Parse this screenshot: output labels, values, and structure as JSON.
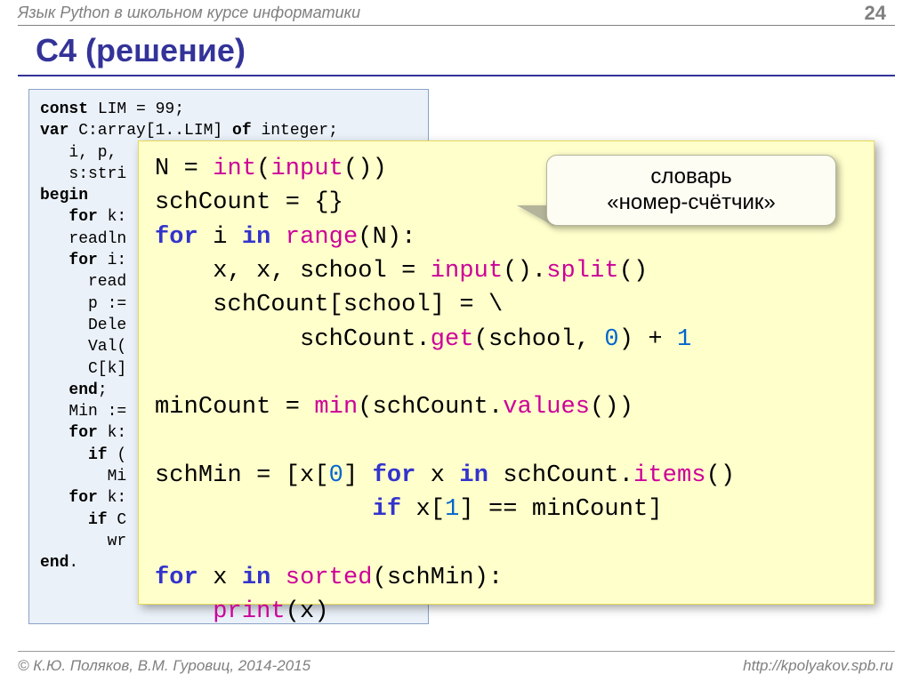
{
  "header": {
    "course": "Язык Python в школьном курсе информатики",
    "page": "24"
  },
  "title": "C4 (решение)",
  "pascal": {
    "l1a": "const",
    "l1b": " LIM = 99;",
    "l2a": "var",
    "l2b": " C:array[1..LIM] ",
    "l2c": "of",
    "l2d": " integer;",
    "l3": "   i, p, ",
    "l4": "   s:stri",
    "l5a": "begin",
    "l6a": "   for",
    "l6b": " k:",
    "l7": "   readln",
    "l8a": "   for",
    "l8b": " i:",
    "l9": "     read",
    "l10": "     p :=",
    "l11": "     Dele",
    "l12": "     Val(",
    "l13": "     C[k]",
    "l14a": "   end",
    "l14b": ";",
    "l15": "   Min :=",
    "l16a": "   for",
    "l16b": " k:",
    "l17a": "     if",
    "l17b": " (",
    "l18": "       Mi",
    "l19a": "   for",
    "l19b": " k:",
    "l20a": "     if",
    "l20b": " C",
    "l21": "       wr",
    "l22a": "end",
    "l22b": "."
  },
  "python": {
    "l1a": "N = ",
    "l1b": "int",
    "l1c": "(",
    "l1d": "input",
    "l1e": "())",
    "l2": "schCount = {}",
    "l3a": "for",
    "l3b": " i ",
    "l3c": "in",
    "l3d": " ",
    "l3e": "range",
    "l3f": "(N):",
    "l4a": "    x, x, school = ",
    "l4b": "input",
    "l4c": "().",
    "l4d": "split",
    "l4e": "()",
    "l5": "    schCount[school] = \\",
    "l6a": "          schCount.",
    "l6b": "get",
    "l6c": "(school, ",
    "l6d": "0",
    "l6e": ") + ",
    "l6f": "1",
    "gap1": "",
    "l7a": "minCount = ",
    "l7b": "min",
    "l7c": "(schCount.",
    "l7d": "values",
    "l7e": "())",
    "gap2": "",
    "l8a": "schMin = [x[",
    "l8b": "0",
    "l8c": "] ",
    "l8d": "for",
    "l8e": " x ",
    "l8f": "in",
    "l8g": " schCount.",
    "l8h": "items",
    "l8i": "()",
    "l9a": "               ",
    "l9b": "if",
    "l9c": " x[",
    "l9d": "1",
    "l9e": "] == minCount]",
    "gap3": "",
    "l10a": "for",
    "l10b": " x ",
    "l10c": "in",
    "l10d": " ",
    "l10e": "sorted",
    "l10f": "(schMin):",
    "l11a": "    ",
    "l11b": "print",
    "l11c": "(x)"
  },
  "bubble": {
    "line1": "словарь",
    "line2": "«номер-счётчик»"
  },
  "footer": {
    "left": "© К.Ю. Поляков, В.М. Гуровиц, 2014-2015",
    "right": "http://kpolyakov.spb.ru"
  }
}
